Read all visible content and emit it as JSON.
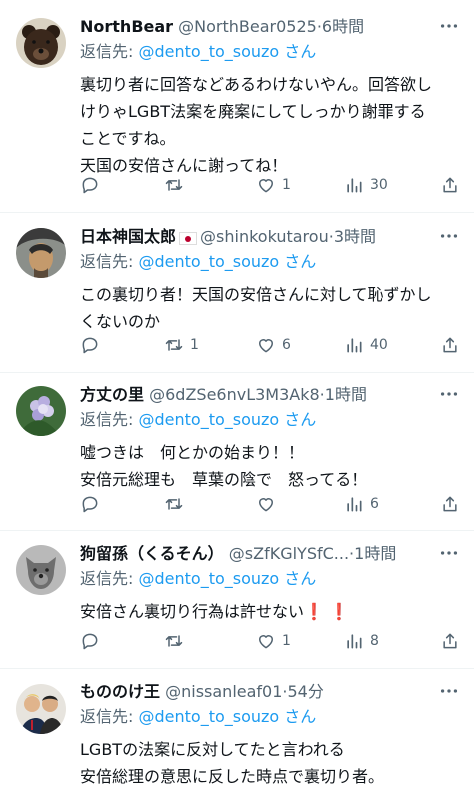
{
  "reply_prefix": "返信先: ",
  "reply_suffix": " さん",
  "mention": "@dento_to_souzo",
  "tweets": [
    {
      "name": "NorthBear",
      "handle": "@NorthBear0525",
      "time": "6時間",
      "lines": [
        "裏切り者に回答などあるわけないやん。回答欲し",
        "けりゃLGBT法案を廃案にしてしっかり謝罪する",
        "ことですね。",
        "天国の安倍さんに謝ってね！"
      ],
      "replies": "",
      "retweets": "",
      "likes": "1",
      "views": "30"
    },
    {
      "name": "日本神国太郎",
      "handle": "@shinkokutarou",
      "time": "3時間",
      "lines": [
        "この裏切り者！天国の安倍さんに対して恥ずかし",
        "くないのか"
      ],
      "replies": "",
      "retweets": "1",
      "likes": "6",
      "views": "40"
    },
    {
      "name": "方丈の里",
      "handle": "@6dZSe6nvL3M3Ak8",
      "time": "1時間",
      "lines": [
        "嘘つきは　何とかの始まり！！",
        "安倍元総理も　草葉の陰で　怒ってる！"
      ],
      "replies": "",
      "retweets": "",
      "likes": "",
      "views": "6"
    },
    {
      "name": "狗留孫（くるそん）",
      "handle": "@sZfKGlYSfC...",
      "time": "1時間",
      "lines": [
        "安倍さん裏切り行為は許せない"
      ],
      "emoji": "❗ ❗",
      "replies": "",
      "retweets": "",
      "likes": "1",
      "views": "8"
    },
    {
      "name": "もののけ王",
      "handle": "@nissanleaf01",
      "time": "54分",
      "lines": [
        "LGBTの法案に反対してたと言われる",
        "安倍総理の意思に反した時点で裏切り者。"
      ],
      "replies": "",
      "retweets": "",
      "likes": "",
      "views": ""
    }
  ]
}
